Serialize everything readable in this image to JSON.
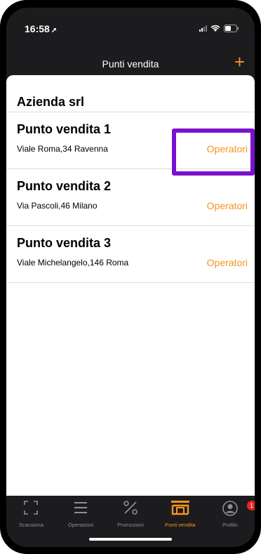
{
  "status": {
    "time": "16:58"
  },
  "header": {
    "title": "Punti vendita"
  },
  "company": "Azienda srl",
  "stores": [
    {
      "name": "Punto vendita 1",
      "address": "Viale Roma,34 Ravenna",
      "action": "Operatori"
    },
    {
      "name": "Punto vendita  2",
      "address": "Via Pascoli,46 Milano",
      "action": "Operatori"
    },
    {
      "name": "Punto vendita  3",
      "address": "Viale Michelangelo,146 Roma",
      "action": "Operatori"
    }
  ],
  "tabs": [
    {
      "label": "Scansiona",
      "icon": "scan-icon"
    },
    {
      "label": "Operazioni",
      "icon": "list-icon"
    },
    {
      "label": "Promozioni",
      "icon": "percent-icon"
    },
    {
      "label": "Punti vendita",
      "icon": "store-icon",
      "active": true
    },
    {
      "label": "Profilo",
      "icon": "profile-icon",
      "badge": "1"
    }
  ],
  "colors": {
    "accent": "#f7941d",
    "highlight": "#7b10d0",
    "badge": "#e8261f",
    "bar": "#1c1c1e"
  }
}
